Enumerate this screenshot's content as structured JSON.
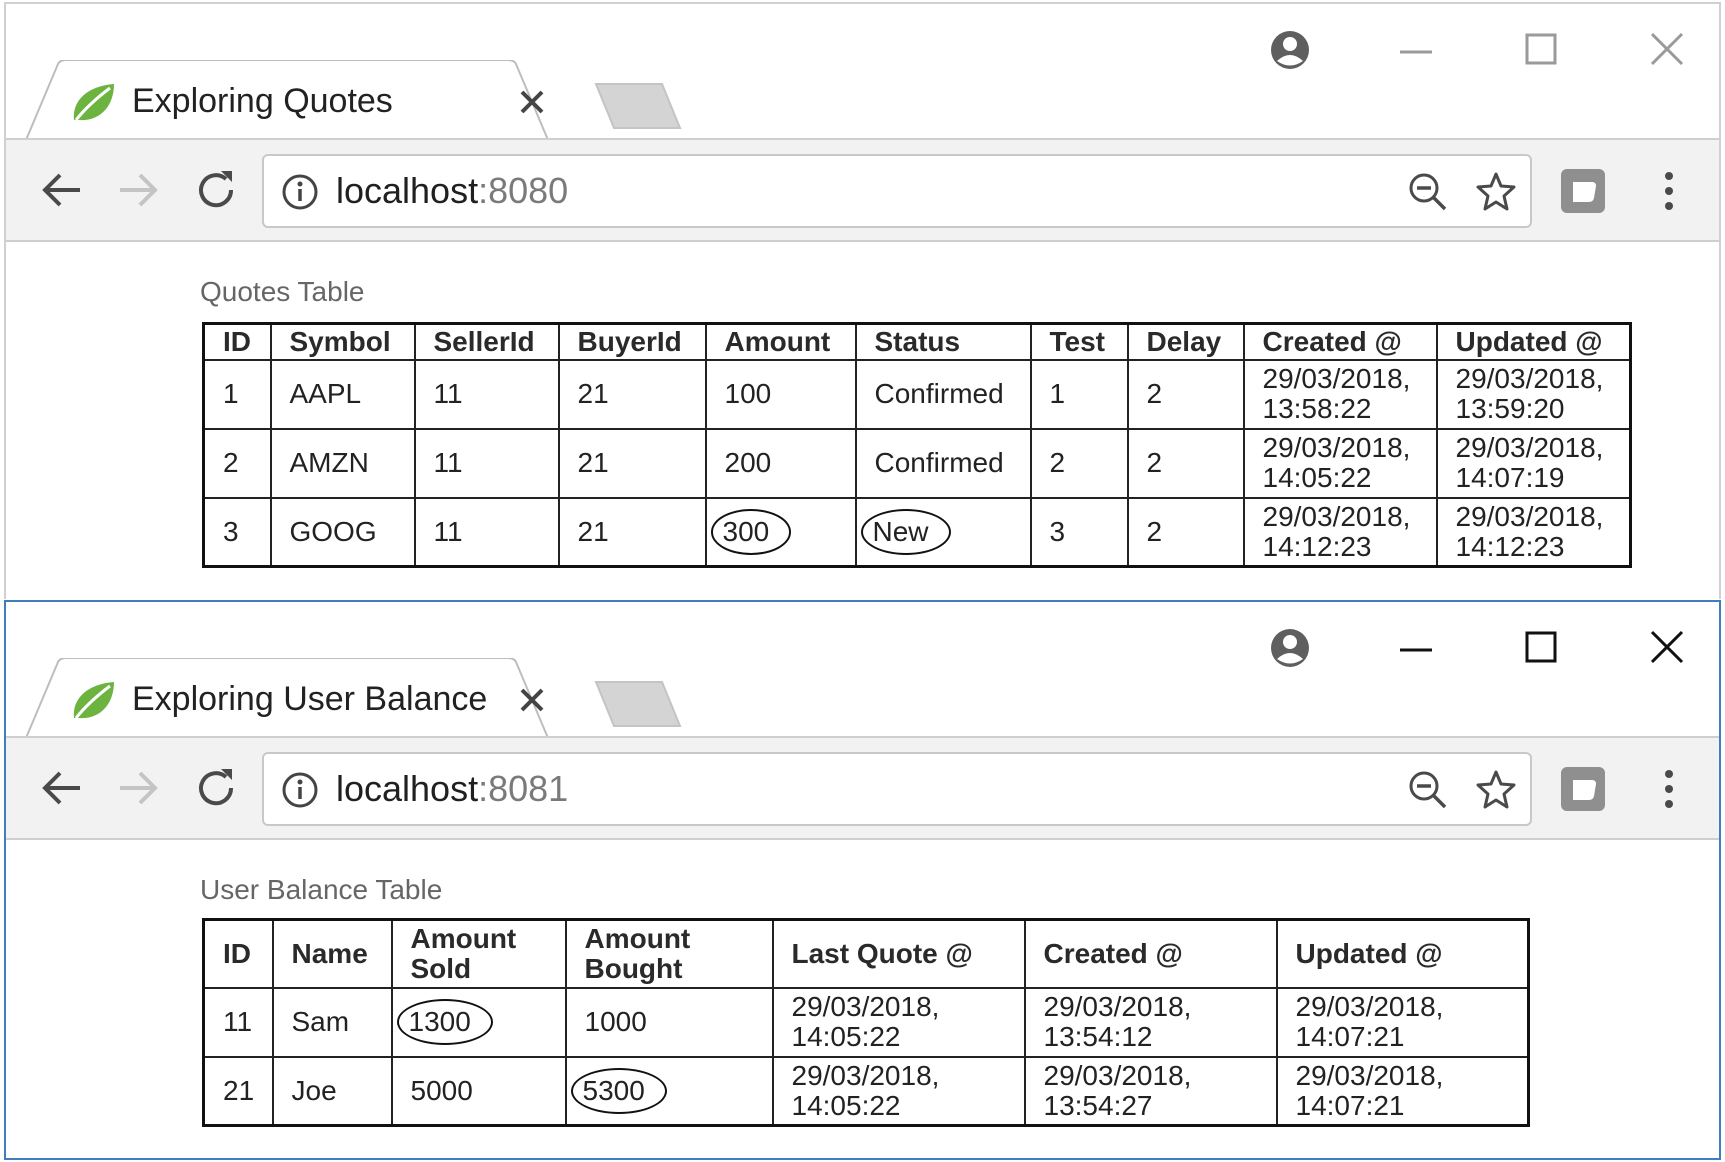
{
  "windows": [
    {
      "tab": {
        "title": "Exploring Quotes"
      },
      "address": {
        "host": "localhost",
        "port": ":8080"
      },
      "table_title": "Quotes Table",
      "headers": [
        "ID",
        "Symbol",
        "SellerId",
        "BuyerId",
        "Amount",
        "Status",
        "Test",
        "Delay",
        "Created @",
        "Updated @"
      ],
      "rows": [
        {
          "id": "1",
          "symbol": "AAPL",
          "seller_id": "11",
          "buyer_id": "21",
          "amount": "100",
          "status": "Confirmed",
          "test": "1",
          "delay": "2",
          "created": [
            "29/03/2018,",
            "13:58:22"
          ],
          "updated": [
            "29/03/2018,",
            "13:59:20"
          ]
        },
        {
          "id": "2",
          "symbol": "AMZN",
          "seller_id": "11",
          "buyer_id": "21",
          "amount": "200",
          "status": "Confirmed",
          "test": "2",
          "delay": "2",
          "created": [
            "29/03/2018,",
            "14:05:22"
          ],
          "updated": [
            "29/03/2018,",
            "14:07:19"
          ]
        },
        {
          "id": "3",
          "symbol": "GOOG",
          "seller_id": "11",
          "buyer_id": "21",
          "amount": "300",
          "status": "New",
          "test": "3",
          "delay": "2",
          "created": [
            "29/03/2018,",
            "14:12:23"
          ],
          "updated": [
            "29/03/2018,",
            "14:12:23"
          ]
        }
      ]
    },
    {
      "tab": {
        "title": "Exploring User Balance"
      },
      "address": {
        "host": "localhost",
        "port": ":8081"
      },
      "table_title": "User Balance Table",
      "headers": [
        "ID",
        "Name",
        [
          "Amount",
          "Sold"
        ],
        [
          "Amount",
          "Bought"
        ],
        "Last Quote @",
        "Created @",
        "Updated @"
      ],
      "rows": [
        {
          "id": "11",
          "name": "Sam",
          "amount_sold": "1300",
          "amount_bought": "1000",
          "last_quote": [
            "29/03/2018,",
            "14:05:22"
          ],
          "created": [
            "29/03/2018,",
            "13:54:12"
          ],
          "updated": [
            "29/03/2018,",
            "14:07:21"
          ]
        },
        {
          "id": "21",
          "name": "Joe",
          "amount_sold": "5000",
          "amount_bought": "5300",
          "last_quote": [
            "29/03/2018,",
            "14:05:22"
          ],
          "created": [
            "29/03/2018,",
            "13:54:27"
          ],
          "updated": [
            "29/03/2018,",
            "14:07:21"
          ]
        }
      ]
    }
  ],
  "colors": {
    "toolbar_bg": "#f2f2f2",
    "active_window_border": "#3f7fbf",
    "favicon_green": "#6db33f",
    "caption_text": "#666666",
    "port_text": "#7a7a7a"
  },
  "icons": [
    "spring-leaf-icon",
    "close-icon",
    "account-icon",
    "minimize-icon",
    "maximize-icon",
    "back-arrow-icon",
    "forward-arrow-icon",
    "reload-icon",
    "info-icon",
    "zoom-out-icon",
    "star-icon",
    "extension-icon",
    "menu-dots-icon"
  ]
}
